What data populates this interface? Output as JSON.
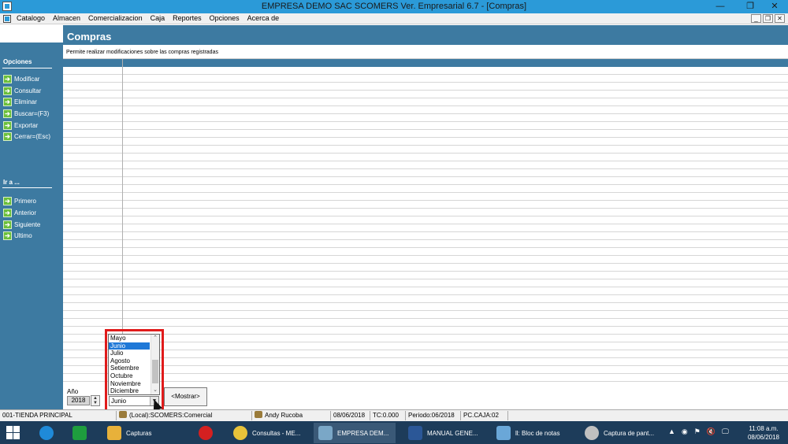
{
  "window": {
    "title": "EMPRESA DEMO SAC          SCOMERS Ver. Empresarial  6.7 - [Compras]",
    "minimize": "—",
    "restore": "❐",
    "close": "✕"
  },
  "menu": {
    "items": [
      "Catalogo",
      "Almacen",
      "Comercializacion",
      "Caja",
      "Reportes",
      "Opciones",
      "Acerca de"
    ],
    "mdi_minimize": "_",
    "mdi_restore": "❐",
    "mdi_close": "✕"
  },
  "sidebar": {
    "options_title": "Opciones",
    "options": [
      "Modificar",
      "Consultar",
      "Eliminar",
      "Buscar=(F3)",
      "Exportar",
      "Cerrar=(Esc)"
    ],
    "goto_title": "Ir a ...",
    "goto": [
      "Primero",
      "Anterior",
      "Siguiente",
      "Ultimo"
    ]
  },
  "main": {
    "title": "Compras",
    "subtitle": "Permite realizar modificaciones sobre las compras registradas"
  },
  "filters": {
    "year_label": "Año",
    "year_value": "2018",
    "month_value": "Junio",
    "show_button": "<Mostrar>",
    "month_options": [
      "Mayo",
      "Junio",
      "Julio",
      "Agosto",
      "Setiembre",
      "Octubre",
      "Noviembre",
      "Diciembre"
    ],
    "selected_month": "Junio"
  },
  "status": {
    "store": "001-TIENDA PRINCIPAL",
    "module": "(Local):SCOMERS:Comercial",
    "user": "Andy Rucoba",
    "date": "08/06/2018",
    "tc": "TC:0.000",
    "period": "Periodo:06/2018",
    "pc": "PC.CAJA:02"
  },
  "taskbar": {
    "apps": [
      {
        "label": "",
        "color": "#1f8ad8",
        "icon": "internet-explorer-icon"
      },
      {
        "label": "",
        "color": "#1e9e3e",
        "icon": "store-icon"
      },
      {
        "label": "Capturas",
        "color": "#e8b13a",
        "icon": "folder-icon"
      },
      {
        "label": "",
        "color": "#d42020",
        "icon": "opera-icon"
      },
      {
        "label": "Consultas - ME...",
        "color": "#e8c33a",
        "icon": "chrome-icon"
      },
      {
        "label": "EMPRESA DEM...",
        "color": "#7aa7c7",
        "icon": "scomers-icon"
      },
      {
        "label": "MANUAL GENE...",
        "color": "#2b5797",
        "icon": "word-icon"
      },
      {
        "label": "ll: Bloc de notas",
        "color": "#6aa7d8",
        "icon": "notepad-icon"
      },
      {
        "label": "Captura de pant...",
        "color": "#c0c0c0",
        "icon": "snipping-icon"
      }
    ],
    "tray": [
      "▲",
      "◉",
      "⚑",
      "🔇",
      "🖵"
    ],
    "time": "11:08 a.m.",
    "date": "08/06/2018"
  }
}
